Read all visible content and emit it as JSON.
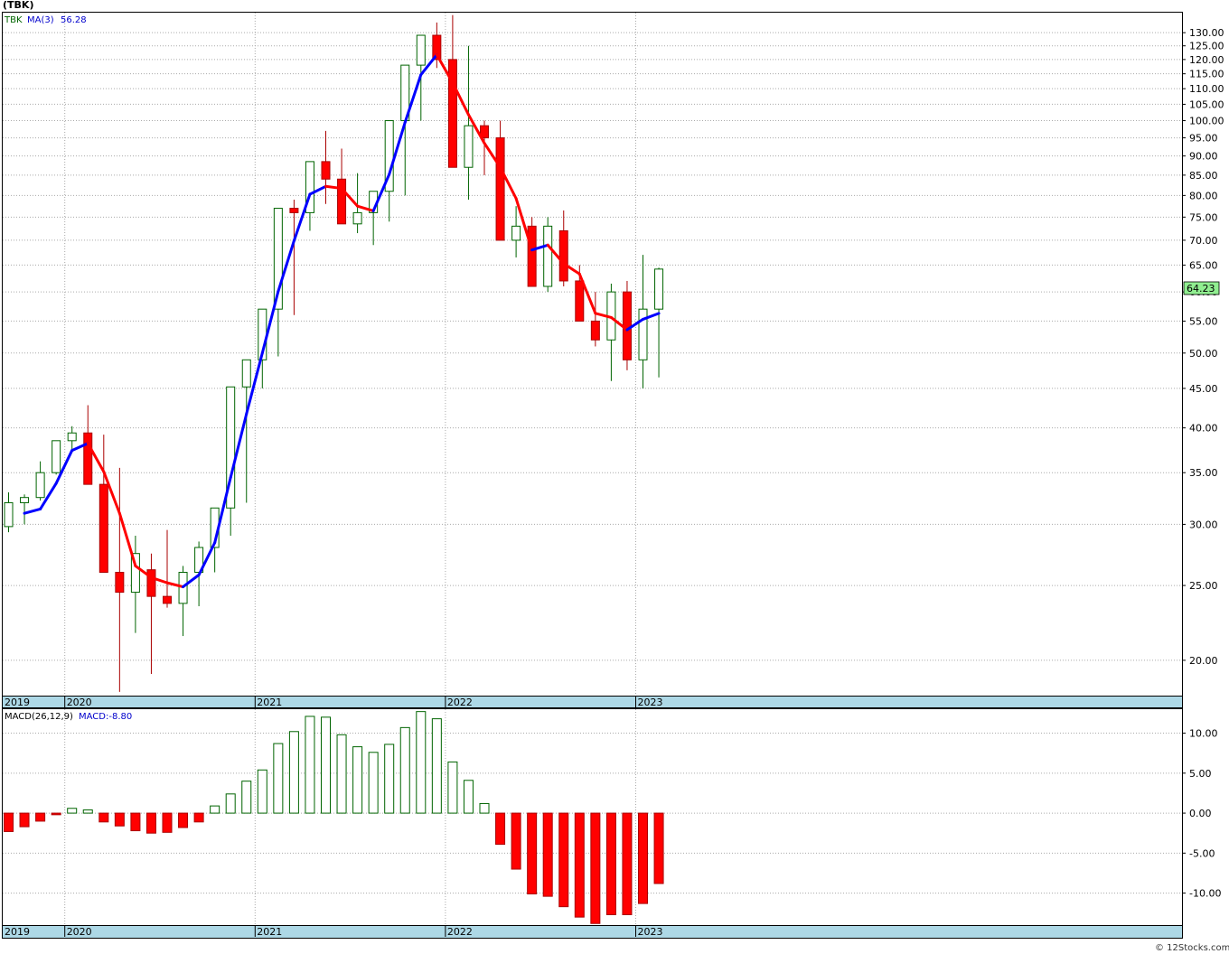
{
  "header": {
    "title": "(TBK)"
  },
  "legend": {
    "ticker": "TBK",
    "ma_label": "MA(3)",
    "ma_value": "56.28"
  },
  "macd_legend": {
    "label": "MACD(26,12,9)",
    "value": "MACD:-8.80"
  },
  "price_badge": "64.23",
  "footer": {
    "credit": "© 12Stocks.com"
  },
  "colors": {
    "up": "#006400",
    "down": "#ff0000",
    "ma_up": "#0000ff",
    "ma_down": "#ff0000",
    "grid": "#aaaaaa",
    "axis_band": "#add8e6"
  },
  "chart_data": [
    {
      "type": "candlestick",
      "scale": "log",
      "interval": "monthly",
      "ylim": [
        18,
        138
      ],
      "y_ticks": [
        "20.00",
        "25.00",
        "30.00",
        "35.00",
        "40.00",
        "45.00",
        "50.00",
        "55.00",
        "60.00",
        "65.00",
        "70.00",
        "75.00",
        "80.00",
        "85.00",
        "90.00",
        "95.00",
        "100.00",
        "105.00",
        "110.00",
        "115.00",
        "120.00",
        "125.00",
        "130.00"
      ],
      "y_tick_values": [
        20,
        25,
        30,
        35,
        40,
        45,
        50,
        55,
        60,
        65,
        70,
        75,
        80,
        85,
        90,
        95,
        100,
        105,
        110,
        115,
        120,
        125,
        130
      ],
      "x_tick_labels": [
        "2019",
        "2020",
        "2021",
        "2022",
        "2023"
      ],
      "x_tick_index": [
        0,
        4,
        16,
        28,
        40
      ],
      "months": [
        "2019-09",
        "2019-10",
        "2019-11",
        "2019-12",
        "2020-01",
        "2020-02",
        "2020-03",
        "2020-04",
        "2020-05",
        "2020-06",
        "2020-07",
        "2020-08",
        "2020-09",
        "2020-10",
        "2020-11",
        "2020-12",
        "2021-01",
        "2021-02",
        "2021-03",
        "2021-04",
        "2021-05",
        "2021-06",
        "2021-07",
        "2021-08",
        "2021-09",
        "2021-10",
        "2021-11",
        "2021-12",
        "2022-01",
        "2022-02",
        "2022-03",
        "2022-04",
        "2022-05",
        "2022-06",
        "2022-07",
        "2022-08",
        "2022-09",
        "2022-10",
        "2022-11",
        "2022-12",
        "2023-01",
        "2023-02"
      ],
      "open": [
        29.8,
        32.0,
        32.5,
        35.0,
        38.5,
        39.4,
        33.8,
        26.0,
        24.5,
        26.2,
        24.2,
        23.7,
        26.0,
        28.0,
        31.5,
        45.2,
        49.0,
        57.0,
        77.0,
        76.0,
        88.5,
        84.0,
        73.5,
        76.0,
        81.0,
        100.0,
        118.0,
        129.0,
        120.0,
        87.0,
        98.5,
        95.0,
        70.0,
        73.0,
        61.0,
        72.0,
        62.0,
        55.0,
        52.0,
        60.0,
        49.0,
        57.0
      ],
      "high": [
        33.0,
        32.8,
        36.2,
        38.5,
        40.2,
        42.8,
        39.2,
        35.5,
        29.0,
        27.5,
        29.5,
        26.5,
        28.5,
        30.5,
        33.0,
        46.5,
        50.0,
        58.5,
        79.0,
        79.0,
        97.0,
        92.0,
        85.5,
        79.0,
        84.0,
        102.0,
        118.5,
        134.0,
        137.0,
        125.0,
        100.0,
        100.0,
        77.5,
        75.0,
        75.0,
        76.5,
        65.0,
        60.0,
        61.5,
        62.0,
        67.0,
        64.5
      ],
      "low": [
        29.3,
        30.0,
        32.2,
        34.8,
        37.5,
        38.3,
        33.2,
        18.2,
        21.7,
        19.2,
        23.4,
        21.5,
        23.5,
        26.0,
        29.0,
        32.0,
        45.0,
        49.5,
        56.0,
        72.0,
        78.0,
        82.0,
        71.5,
        69.0,
        74.0,
        80.0,
        100.0,
        117.0,
        105.0,
        79.0,
        85.0,
        88.5,
        66.5,
        62.0,
        60.0,
        61.0,
        60.0,
        51.0,
        46.0,
        47.5,
        45.0,
        46.5
      ],
      "close": [
        32.0,
        32.5,
        35.0,
        38.5,
        39.4,
        33.8,
        26.0,
        24.5,
        27.5,
        24.2,
        23.7,
        26.0,
        28.0,
        31.5,
        45.2,
        49.0,
        57.0,
        77.0,
        76.0,
        88.5,
        84.0,
        73.5,
        76.0,
        81.0,
        100.0,
        118.0,
        129.0,
        120.0,
        87.0,
        98.5,
        95.0,
        70.0,
        73.0,
        61.0,
        73.0,
        62.0,
        55.0,
        52.0,
        60.0,
        49.0,
        57.0,
        64.23
      ],
      "ma3": [
        null,
        31.0,
        31.4,
        33.9,
        37.4,
        38.2,
        35.1,
        31.0,
        26.5,
        25.6,
        25.2,
        24.9,
        25.8,
        28.4,
        34.5,
        41.7,
        50.0,
        60.1,
        69.9,
        80.3,
        82.2,
        81.7,
        77.5,
        76.4,
        85.2,
        99.5,
        114.7,
        121.7,
        112.0,
        101.8,
        93.5,
        87.0,
        79.3,
        68.0,
        69.0,
        65.3,
        63.3,
        56.3,
        55.6,
        53.6,
        55.3,
        56.28
      ]
    },
    {
      "type": "bar",
      "title": "MACD(26,12,9)",
      "ylim": [
        -14,
        13
      ],
      "y_ticks": [
        "-10.00",
        "-5.00",
        "0.00",
        "5.00",
        "10.00"
      ],
      "y_tick_values": [
        -10,
        -5,
        0,
        5,
        10
      ],
      "x_tick_labels": [
        "2019",
        "2020",
        "2021",
        "2022",
        "2023"
      ],
      "values": [
        -2.3,
        -1.7,
        -1.0,
        -0.2,
        0.6,
        0.4,
        -1.1,
        -1.6,
        -2.2,
        -2.5,
        -2.4,
        -1.8,
        -1.1,
        0.9,
        2.4,
        4.0,
        5.4,
        8.7,
        10.2,
        12.1,
        12.0,
        9.8,
        8.3,
        7.6,
        8.6,
        10.7,
        12.7,
        11.8,
        6.4,
        4.1,
        1.2,
        -3.9,
        -7.0,
        -10.1,
        -10.4,
        -11.7,
        -13.0,
        -13.8,
        -12.7,
        -12.7,
        -11.3,
        -8.8
      ]
    }
  ]
}
